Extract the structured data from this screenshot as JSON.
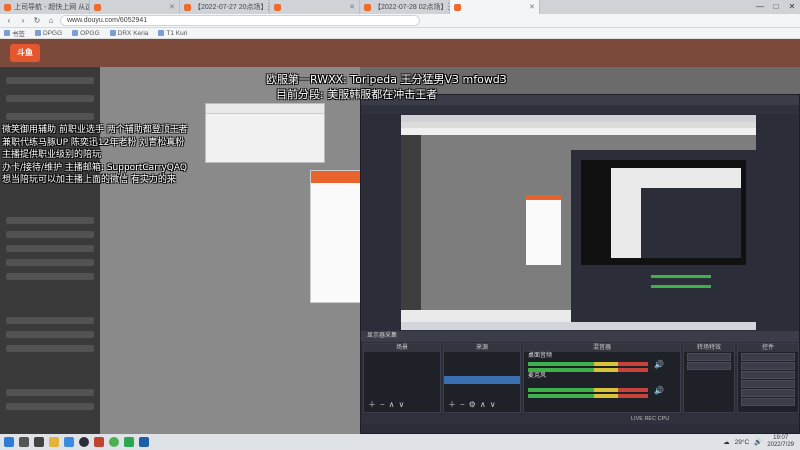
{
  "browser": {
    "tabs": [
      {
        "label": "上司导航 - 超快上网 从这里开始",
        "active": false
      },
      {
        "label": "",
        "active": false
      },
      {
        "label": "【2022-07-27 20点场】天才辅",
        "active": false
      },
      {
        "label": "",
        "active": false
      },
      {
        "label": "【2022-07-28 02点场】天才辅助",
        "active": false
      },
      {
        "label": "",
        "active": true
      }
    ],
    "window_controls": [
      "—",
      "□",
      "✕"
    ],
    "url": "www.douyu.com/6052941",
    "bookmarks": [
      {
        "label": "书签"
      },
      {
        "label": "DPGG"
      },
      {
        "label": "OPGG"
      },
      {
        "label": "DRX Keria"
      },
      {
        "label": "T1 Kuri"
      }
    ]
  },
  "site": {
    "logo_text": "斗鱼",
    "nav": []
  },
  "overlays": {
    "top_line1": "欧服第一RWXX: Toripeda 王分猛男V3 mfowd3",
    "top_line2": "目前分段: 美服韩服都在冲击王者",
    "left_lines": [
      "微笑御用辅助 前职业选手 两个辅助都登顶王者",
      "兼职代练马豚UP 陈奕迅12年老粉 刘青松真粉",
      "主播提供职业级别的陪玩",
      "办卡/接待/维护 主播邮箱: SupportCarryQAQ",
      "想当陪玩可以加主播上面的微信 有实力的来"
    ]
  },
  "obs": {
    "title": "",
    "menu": [
      "",
      "",
      "",
      "",
      "",
      ""
    ],
    "scene_strip": "显示器采集",
    "docks": [
      {
        "title": "场景",
        "items": []
      },
      {
        "title": "来源",
        "items": [
          "",
          "",
          "",
          ""
        ]
      },
      {
        "title": "混音器",
        "channels": [
          "桌面音频",
          "麦克风"
        ]
      },
      {
        "title": "转场特效",
        "items": []
      },
      {
        "title": "控件",
        "buttons": [
          "",
          "",
          "",
          "",
          "",
          "",
          ""
        ]
      }
    ],
    "status": "LIVE  REC  CPU"
  },
  "taskbar": {
    "weather": "29°C",
    "time": "19:07",
    "date": "2022/7/29"
  },
  "colors": {
    "accent": "#e8642c",
    "obs_bg": "#2b2e38",
    "site_header": "#7c4a3a"
  }
}
